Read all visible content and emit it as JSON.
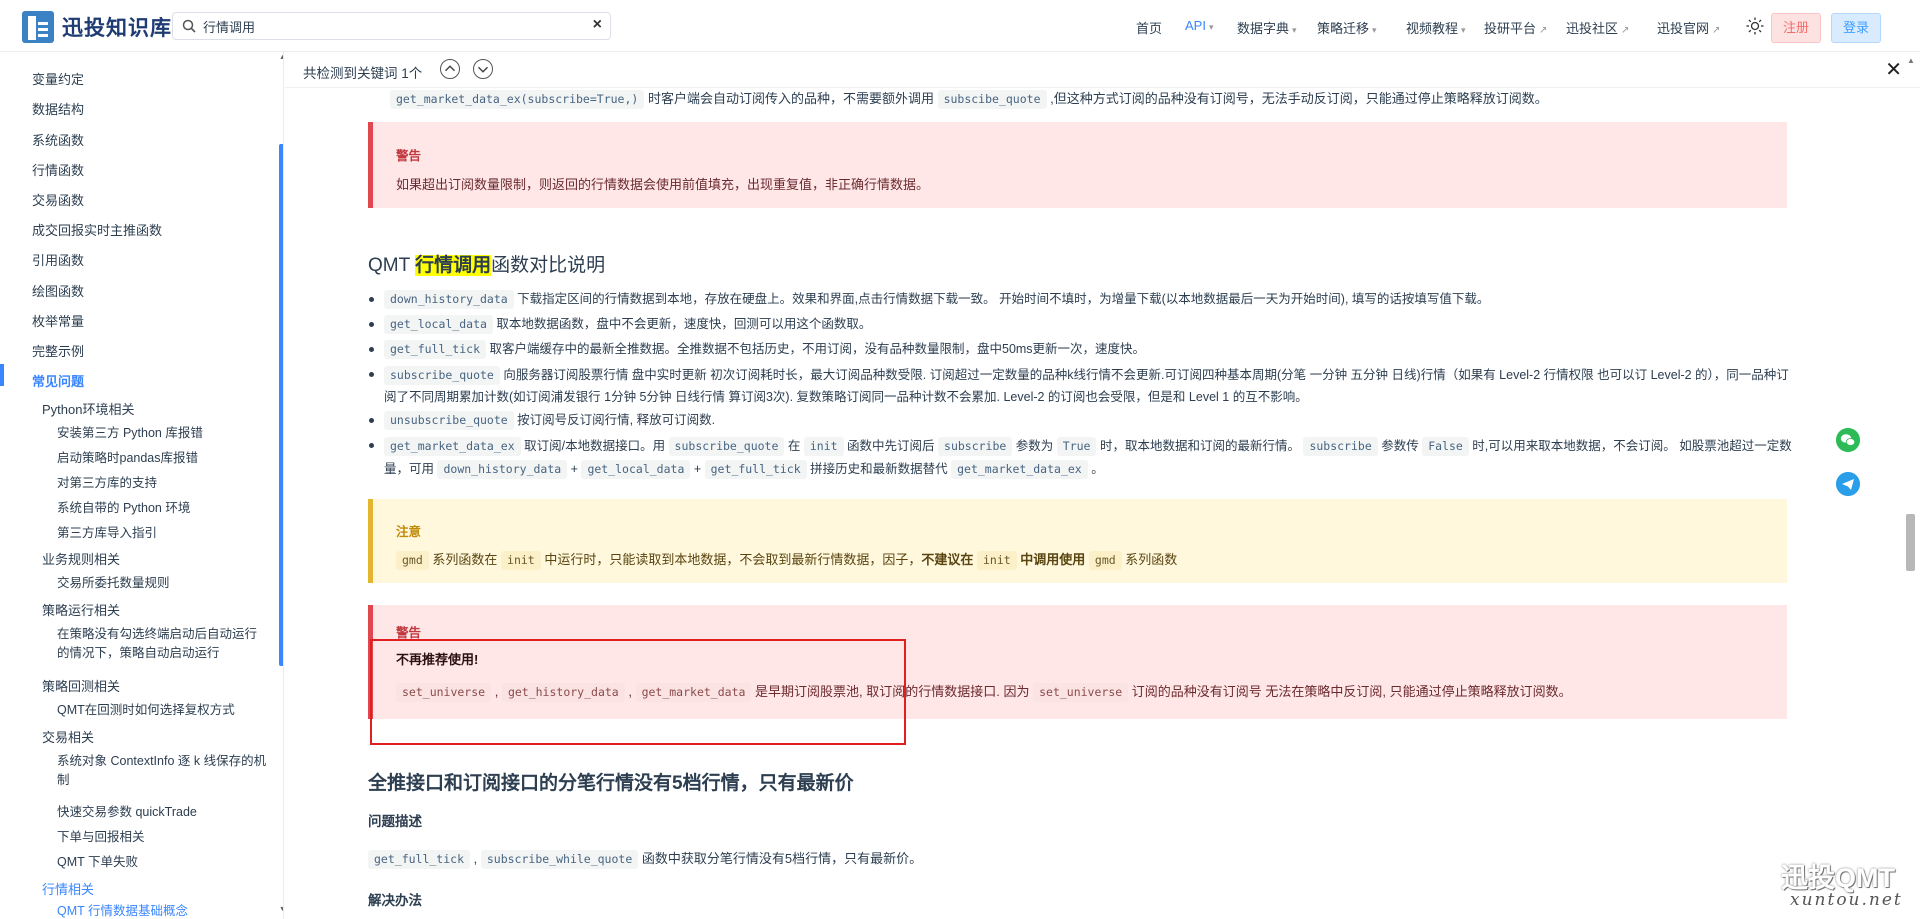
{
  "brand": {
    "name": "迅投知识库"
  },
  "search": {
    "value": "行情调用",
    "clear_icon": "×"
  },
  "nav": [
    {
      "label": "首页"
    },
    {
      "label": "API",
      "active": true,
      "dropdown": true
    },
    {
      "label": "数据字典",
      "dropdown": true
    },
    {
      "label": "策略迁移",
      "dropdown": true
    },
    {
      "label": "视频教程",
      "dropdown": true
    },
    {
      "label": "投研平台",
      "external": true
    },
    {
      "label": "迅投社区",
      "external": true
    },
    {
      "label": "迅投官网",
      "external": true
    }
  ],
  "auth": {
    "register": "注册",
    "login": "登录"
  },
  "sidebar": {
    "l1": [
      "变量约定",
      "数据结构",
      "系统函数",
      "行情函数",
      "交易函数",
      "成交回报实时主推函数",
      "引用函数",
      "绘图函数",
      "枚举常量",
      "完整示例",
      "常见问题"
    ],
    "python_env": {
      "title": "Python环境相关",
      "items": [
        "安装第三方 Python 库报错",
        "启动策略时pandas库报错",
        "对第三方库的支持",
        "系统自带的 Python 环境",
        "第三方库导入指引"
      ]
    },
    "biz_rules": {
      "title": "业务规则相关",
      "items": [
        "交易所委托数量规则"
      ]
    },
    "strategy_run": {
      "title": "策略运行相关",
      "items": [
        "在策略没有勾选终端启动后自动运行的情况下，策略自动启动运行"
      ]
    },
    "backtest": {
      "title": "策略回测相关",
      "items": [
        "QMT在回测时如何选择复权方式"
      ]
    },
    "trade": {
      "title": "交易相关",
      "items": [
        "系统对象 ContextInfo 逐 k 线保存的机制",
        "快速交易参数 quickTrade",
        "下单与回报相关",
        "QMT 下单失败"
      ]
    },
    "quote": {
      "title": "行情相关",
      "items": [
        "QMT 行情数据基础概念"
      ]
    }
  },
  "findbar": {
    "text": "共检测到关键词 1个",
    "up_icon": "⌃",
    "down_icon": "⌄",
    "close_icon": "✕"
  },
  "content": {
    "top_line": {
      "code1": "get_market_data_ex(subscribe=True,)",
      "t1": " 时客户端会自动订阅传入的品种，不需要额外调用 ",
      "code2": "subscibe_quote",
      "t2": " ,但这种方式订阅的品种没有订阅号，无法手动反订阅，只能通过停止策略释放订阅数。"
    },
    "warning1": {
      "title": "警告",
      "text": "如果超出订阅数量限制，则返回的行情数据会使用前值填充，出现重复值，非正确行情数据。"
    },
    "heading": {
      "pre": "QMT ",
      "highlight": "行情调用",
      "post": "函数对比说明"
    },
    "bullets": {
      "b1": {
        "code": "down_history_data",
        "text": " 下载指定区间的行情数据到本地，存放在硬盘上。效果和界面,点击行情数据下载一致。 开始时间不填时，为增量下载(以本地数据最后一天为开始时间), 填写的话按填写值下载。"
      },
      "b2": {
        "code": "get_local_data",
        "text": " 取本地数据函数，盘中不会更新，速度快，回测可以用这个函数取。"
      },
      "b3": {
        "code": "get_full_tick",
        "text": " 取客户端缓存中的最新全推数据。全推数据不包括历史，不用订阅，没有品种数量限制，盘中50ms更新一次，速度快。"
      },
      "b4": {
        "code": "subscribe_quote",
        "text": " 向服务器订阅股票行情 盘中实时更新 初次订阅耗时长，最大订阅品种数受限. 订阅超过一定数量的品种k线行情不会更新.可订阅四种基本周期(分笔 一分钟 五分钟 日线)行情（如果有 Level-2 行情权限 也可以订 Level-2 的），同一品种订阅了不同周期累加计数(如订阅浦发银行 1分钟 5分钟 日线行情 算订阅3次). 复数策略订阅同一品种计数不会累加. Level-2 的订阅也会受限，但是和 Level 1 的互不影响。"
      },
      "b5": {
        "code": "unsubscribe_quote",
        "text": " 按订阅号反订阅行情, 释放可订阅数."
      },
      "b6": {
        "code": "get_market_data_ex",
        "t1": " 取订阅/本地数据接口。用 ",
        "c2": "subscribe_quote",
        "t2": " 在 ",
        "c3": "init",
        "t3": " 函数中先订阅后 ",
        "c4": "subscribe",
        "t4": " 参数为 ",
        "c5": "True",
        "t5": " 时，取本地数据和订阅的最新行情。 ",
        "c6": "subscribe",
        "t6": " 参数传 ",
        "c7": "False",
        "t7": " 时,可以用来取本地数据，不会订阅。 如股票池超过一定数量，可用 ",
        "c8": "down_history_data",
        "t8": " + ",
        "c9": "get_local_data",
        "t9": " + ",
        "c10": "get_full_tick",
        "t10": " 拼接历史和最新数据替代 ",
        "c11": "get_market_data_ex",
        "t11": " 。"
      }
    },
    "note": {
      "title": "注意",
      "c1": "gmd",
      "t1": " 系列函数在 ",
      "c2": "init",
      "t2": " 中运行时，只能读取到本地数据，不会取到最新行情数据，因子，",
      "bold1": "不建议在 ",
      "c3": "init",
      "bold2": " 中调用使用 ",
      "c4": "gmd",
      "t3": " 系列函数"
    },
    "warning2": {
      "title": "警告",
      "bold": "不再推荐使用!",
      "c1": "set_universe",
      "s1": " , ",
      "c2": "get_history_data",
      "s2": " , ",
      "c3": "get_market_data",
      "t1": " 是早期订阅股票池, 取订阅的行情数据接口. 因为 ",
      "c4": "set_universe",
      "t2": " 订阅的品种没有订阅号 无法在策略中反订阅, 只能通过停止策略释放订阅数。"
    },
    "heading2": "全推接口和订阅接口的分笔行情没有5档行情，只有最新价",
    "problem": {
      "title": "问题描述",
      "c1": "get_full_tick",
      "s1": " , ",
      "c2": "subscribe_while_quote",
      "t1": " 函数中获取分笔行情没有5档行情，只有最新价。"
    },
    "solution": {
      "title": "解决办法"
    }
  },
  "watermark": {
    "main": "迅投QMT",
    "sub": "xuntou.net"
  }
}
